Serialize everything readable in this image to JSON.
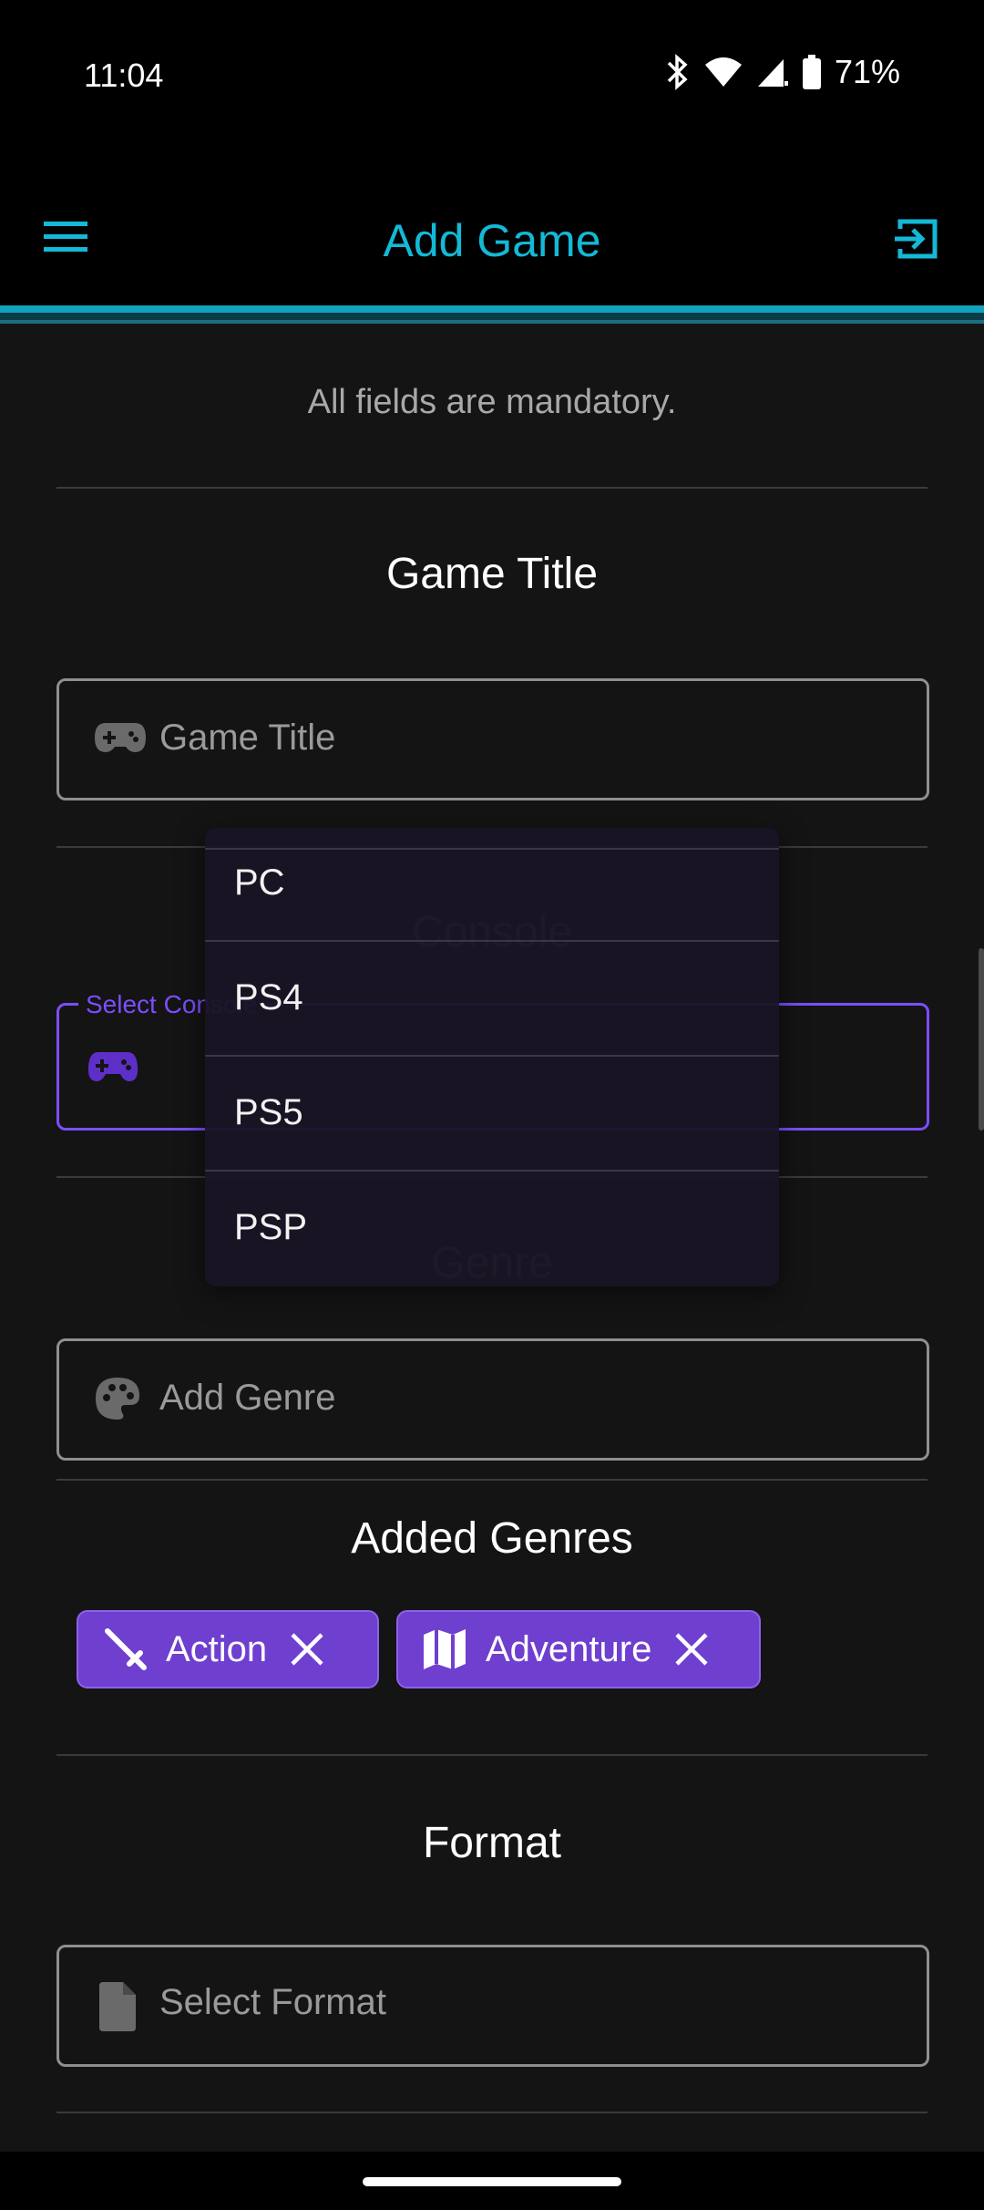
{
  "status_bar": {
    "time": "11:04",
    "battery": "71%"
  },
  "app_bar": {
    "title": "Add Game",
    "menu_icon": "menu-icon",
    "logout_icon": "logout-icon",
    "accent": "#13b9d6"
  },
  "form": {
    "notice": "All fields are mandatory.",
    "game_title": {
      "heading": "Game Title",
      "placeholder": "Game Title",
      "icon": "gamepad-icon"
    },
    "console": {
      "heading": "Console",
      "label": "Select Console",
      "icon": "controller-icon",
      "accent": "#7c4dff"
    },
    "genre": {
      "heading": "Genre",
      "placeholder": "Add Genre",
      "icon": "palette-icon"
    },
    "added_genres": {
      "heading": "Added Genres",
      "chips": [
        {
          "label": "Action",
          "icon": "sword-icon"
        },
        {
          "label": "Adventure",
          "icon": "map-icon"
        }
      ]
    },
    "format": {
      "heading": "Format",
      "placeholder": "Select Format",
      "icon": "file-icon"
    }
  },
  "console_dropdown": {
    "options": [
      "PC",
      "PS4",
      "PS5",
      "PSP"
    ]
  }
}
